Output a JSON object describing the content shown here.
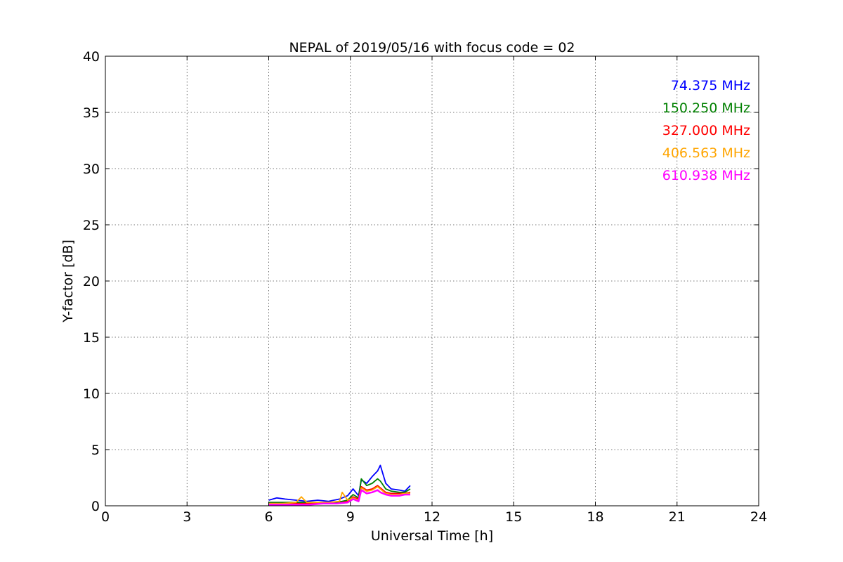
{
  "chart_data": {
    "type": "line",
    "title": "NEPAL of 2019/05/16 with focus code = 02",
    "xlabel": "Universal Time [h]",
    "ylabel": "Y-factor [dB]",
    "xlim": [
      0,
      24
    ],
    "ylim": [
      0,
      40
    ],
    "xticks": [
      0,
      3,
      6,
      9,
      12,
      15,
      18,
      21,
      24
    ],
    "yticks": [
      0,
      5,
      10,
      15,
      20,
      25,
      30,
      35,
      40
    ],
    "grid": true,
    "legend_position": "top-right",
    "series": [
      {
        "name": "74.375 MHz",
        "color": "#0000ff",
        "x": [
          6.0,
          6.3,
          6.6,
          7.0,
          7.4,
          7.8,
          8.2,
          8.6,
          8.9,
          9.1,
          9.3,
          9.4,
          9.6,
          9.8,
          10.0,
          10.1,
          10.3,
          10.5,
          10.8,
          11.0,
          11.2
        ],
        "y": [
          0.5,
          0.7,
          0.6,
          0.5,
          0.4,
          0.5,
          0.4,
          0.6,
          0.9,
          1.5,
          0.9,
          2.3,
          2.0,
          2.6,
          3.1,
          3.6,
          2.0,
          1.5,
          1.4,
          1.3,
          1.8
        ]
      },
      {
        "name": "150.250 MHz",
        "color": "#008000",
        "x": [
          6.0,
          6.5,
          7.0,
          7.5,
          8.0,
          8.5,
          8.9,
          9.1,
          9.3,
          9.4,
          9.6,
          9.8,
          10.0,
          10.1,
          10.3,
          10.5,
          10.8,
          11.0,
          11.2
        ],
        "y": [
          0.3,
          0.3,
          0.3,
          0.3,
          0.3,
          0.3,
          0.5,
          1.0,
          0.7,
          2.4,
          1.8,
          2.0,
          2.4,
          2.2,
          1.5,
          1.3,
          1.2,
          1.2,
          1.5
        ]
      },
      {
        "name": "327.000 MHz",
        "color": "#ff0000",
        "x": [
          6.0,
          6.5,
          7.0,
          7.5,
          8.0,
          8.5,
          8.9,
          9.1,
          9.3,
          9.4,
          9.6,
          9.8,
          10.0,
          10.1,
          10.3,
          10.5,
          10.8,
          11.0,
          11.2
        ],
        "y": [
          0.2,
          0.2,
          0.2,
          0.2,
          0.2,
          0.2,
          0.4,
          0.8,
          0.6,
          1.7,
          1.4,
          1.5,
          1.8,
          1.6,
          1.2,
          1.1,
          1.1,
          1.1,
          1.2
        ]
      },
      {
        "name": "406.563 MHz",
        "color": "#ffa500",
        "x": [
          6.0,
          6.5,
          7.0,
          7.2,
          7.4,
          7.8,
          8.2,
          8.6,
          8.7,
          8.9,
          9.1,
          9.3,
          9.4,
          9.6,
          9.8,
          10.0,
          10.1,
          10.3,
          10.5,
          10.8,
          11.0,
          11.2
        ],
        "y": [
          0.2,
          0.2,
          0.3,
          0.8,
          0.3,
          0.3,
          0.3,
          0.4,
          1.2,
          0.5,
          0.7,
          0.5,
          1.6,
          1.3,
          1.4,
          1.7,
          1.5,
          1.1,
          1.0,
          1.0,
          1.1,
          1.1
        ]
      },
      {
        "name": "610.938 MHz",
        "color": "#ff00ff",
        "x": [
          6.0,
          6.5,
          7.0,
          7.5,
          8.0,
          8.5,
          8.9,
          9.1,
          9.3,
          9.4,
          9.6,
          9.8,
          10.0,
          10.1,
          10.3,
          10.5,
          10.8,
          11.0,
          11.2
        ],
        "y": [
          0.1,
          0.1,
          0.1,
          0.1,
          0.2,
          0.2,
          0.3,
          0.6,
          0.4,
          1.4,
          1.1,
          1.2,
          1.4,
          1.2,
          1.0,
          0.9,
          0.9,
          1.0,
          1.0
        ]
      }
    ]
  }
}
